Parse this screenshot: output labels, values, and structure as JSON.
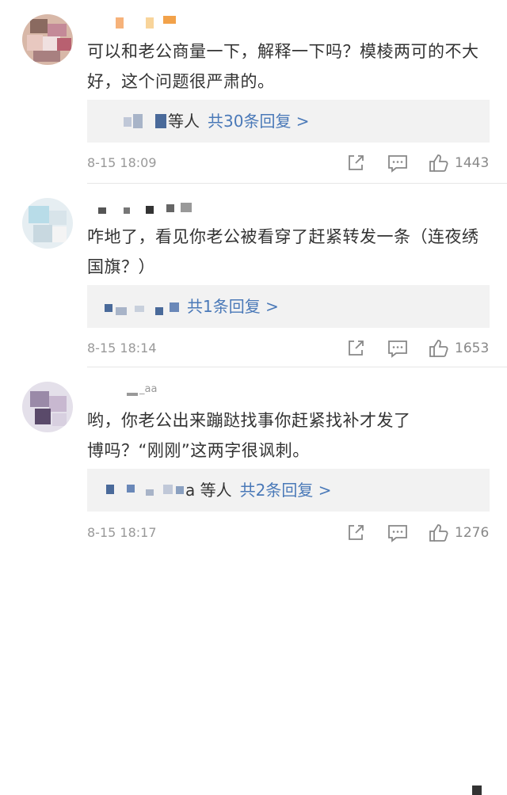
{
  "comments": [
    {
      "text": "可以和老公商量一下，解释一下吗？模棱两可的不大好，这个问题很严肃的。",
      "reply_names": "等人",
      "reply_link": "共30条回复 >",
      "time": "8-15 18:09",
      "likes": "1443"
    },
    {
      "text": "咋地了，看见你老公被看穿了赶紧转发一条（连夜绣国旗？）",
      "reply_names": "",
      "reply_link": "共1条回复 >",
      "time": "8-15 18:14",
      "likes": "1653"
    },
    {
      "text_line1": "哟，你老公出来蹦跶找事你赶紧找补才发了",
      "text_line2": "博吗？“刚刚”这两字很讽刺。",
      "reply_names": "a 等人",
      "reply_link": "共2条回复 >",
      "time": "8-15 18:17",
      "likes": "1276",
      "username_fragment": "_aa"
    }
  ],
  "icons": {
    "share": "share-icon",
    "comment": "comment-icon",
    "like": "thumbs-up-icon"
  },
  "colors": {
    "link": "#4a79b8",
    "text": "#333333",
    "meta": "#999999",
    "reply_bg": "#f2f2f2"
  }
}
